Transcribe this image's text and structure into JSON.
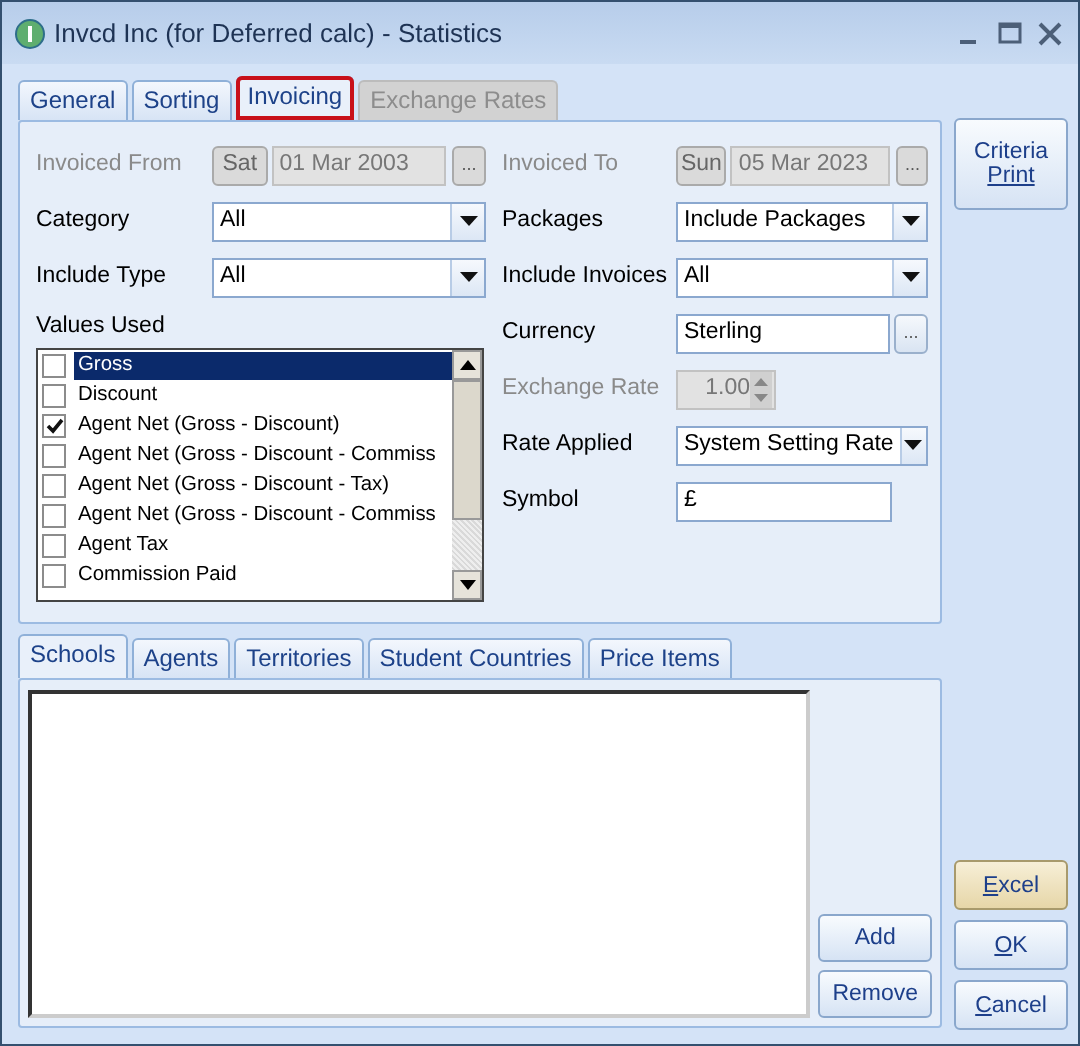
{
  "window": {
    "title": "Invcd Inc (for Deferred calc) - Statistics"
  },
  "tabs": [
    {
      "label": "General",
      "selected": false,
      "disabled": false
    },
    {
      "label": "Sorting",
      "selected": false,
      "disabled": false
    },
    {
      "label": "Invoicing",
      "selected": true,
      "disabled": false
    },
    {
      "label": "Exchange Rates",
      "selected": false,
      "disabled": true
    }
  ],
  "left_fields": [
    {
      "kind": "date",
      "label": "Invoiced From",
      "day": "Sat",
      "date": "01 Mar 2003",
      "button": "...",
      "disabled": true
    },
    {
      "kind": "dropdown",
      "label": "Category",
      "value": "All"
    },
    {
      "kind": "dropdown",
      "label": "Include Type",
      "value": "All"
    }
  ],
  "values_used": {
    "label": "Values Used",
    "items": [
      {
        "label": "Gross",
        "checked": false,
        "selected": true
      },
      {
        "label": "Discount",
        "checked": false,
        "selected": false
      },
      {
        "label": "Agent Net (Gross - Discount)",
        "checked": true,
        "selected": false
      },
      {
        "label": "Agent Net (Gross - Discount - Commiss",
        "checked": false,
        "selected": false
      },
      {
        "label": "Agent Net (Gross - Discount - Tax)",
        "checked": false,
        "selected": false
      },
      {
        "label": "Agent Net (Gross - Discount - Commiss",
        "checked": false,
        "selected": false
      },
      {
        "label": "Agent Tax",
        "checked": false,
        "selected": false
      },
      {
        "label": "Commission Paid",
        "checked": false,
        "selected": false
      }
    ]
  },
  "right_fields": [
    {
      "kind": "date",
      "label": "Invoiced To",
      "day": "Sun",
      "date": "05 Mar 2023",
      "button": "...",
      "disabled": true
    },
    {
      "kind": "dropdown",
      "label": "Packages",
      "value": "Include Packages"
    },
    {
      "kind": "dropdown",
      "label": "Include Invoices",
      "value": "All"
    },
    {
      "kind": "lookup",
      "label": "Currency",
      "value": "Sterling",
      "button": "..."
    },
    {
      "kind": "spinner",
      "label": "Exchange Rate",
      "value": "1.00",
      "disabled": true
    },
    {
      "kind": "dropdown",
      "label": "Rate Applied",
      "value": "System Setting Rate"
    },
    {
      "kind": "text",
      "label": "Symbol",
      "value": "£"
    }
  ],
  "criteria_button": {
    "lines": [
      "Criteria",
      "Print"
    ]
  },
  "lower_tabs": [
    {
      "label": "Schools",
      "selected": true
    },
    {
      "label": "Agents",
      "selected": false
    },
    {
      "label": "Territories",
      "selected": false
    },
    {
      "label": "Student Countries",
      "selected": false
    },
    {
      "label": "Price Items",
      "selected": false
    }
  ],
  "list_buttons": [
    "Add",
    "Remove"
  ],
  "footer_buttons": [
    {
      "label": "Excel",
      "highlighted": true
    },
    {
      "label": "OK",
      "highlighted": false
    },
    {
      "label": "Cancel",
      "highlighted": false
    }
  ]
}
